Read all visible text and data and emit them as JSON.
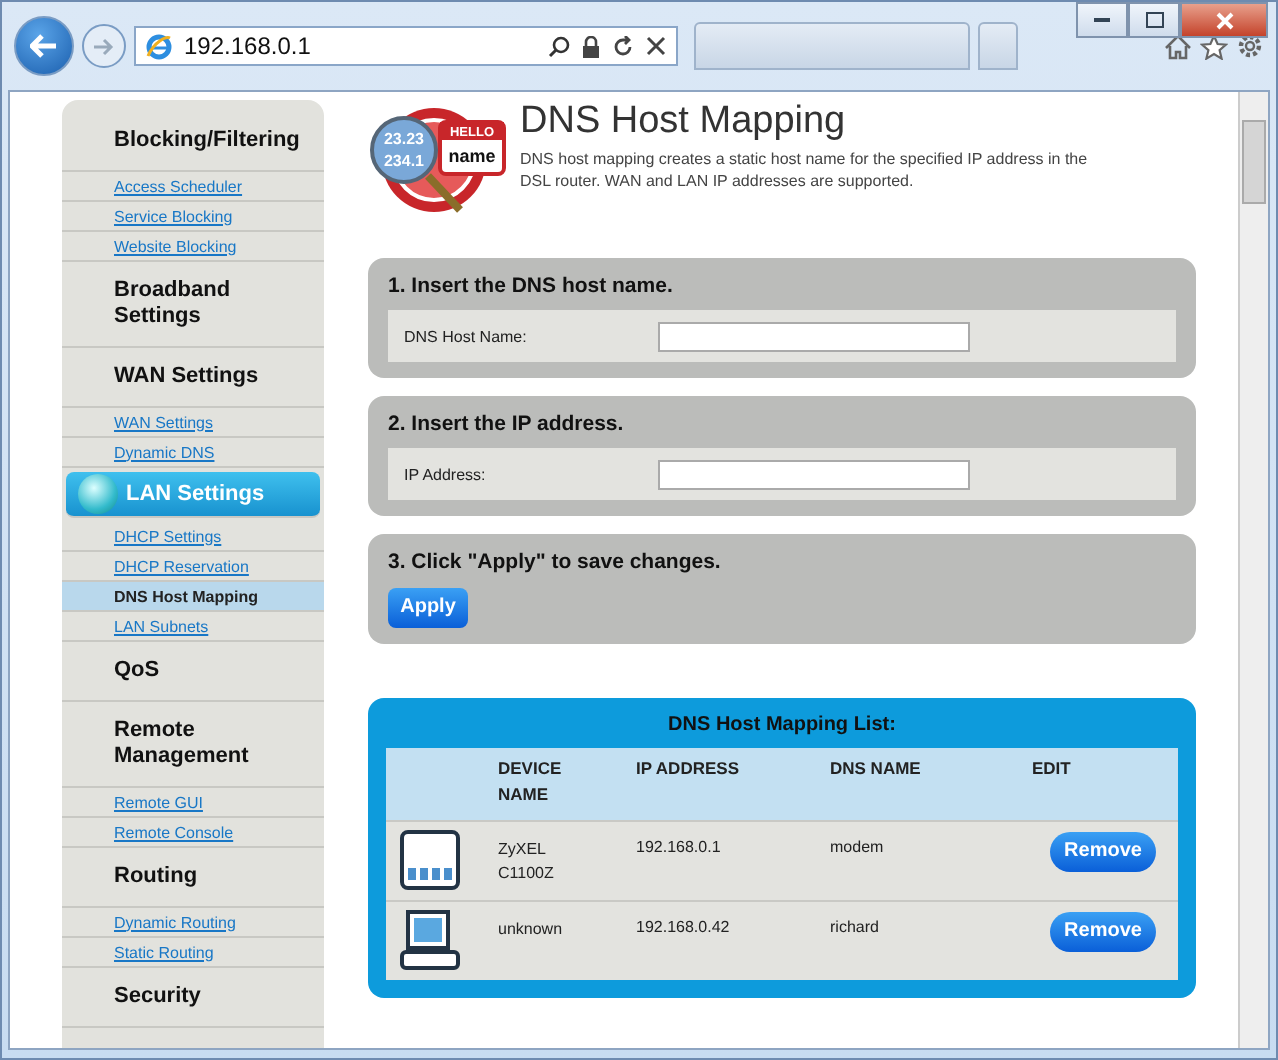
{
  "browser": {
    "address": "192.168.0.1"
  },
  "sidebar": {
    "sections": [
      {
        "title": "Blocking/Filtering",
        "selected": false,
        "links": [
          {
            "label": "Access Scheduler",
            "selected": false
          },
          {
            "label": "Service Blocking",
            "selected": false
          },
          {
            "label": "Website Blocking",
            "selected": false
          }
        ]
      },
      {
        "title": "Broadband Settings",
        "selected": false
      },
      {
        "title": "WAN Settings",
        "selected": false,
        "links": [
          {
            "label": "WAN Settings",
            "selected": false
          },
          {
            "label": "Dynamic DNS",
            "selected": false
          }
        ]
      },
      {
        "title": "LAN Settings",
        "selected": true,
        "links": [
          {
            "label": "DHCP Settings",
            "selected": false
          },
          {
            "label": "DHCP Reservation",
            "selected": false
          },
          {
            "label": "DNS Host Mapping",
            "selected": true
          },
          {
            "label": "LAN Subnets",
            "selected": false
          }
        ]
      },
      {
        "title": "QoS",
        "selected": false
      },
      {
        "title": "Remote Management",
        "selected": false,
        "links": [
          {
            "label": "Remote GUI",
            "selected": false
          },
          {
            "label": "Remote Console",
            "selected": false
          }
        ]
      },
      {
        "title": "Routing",
        "selected": false,
        "links": [
          {
            "label": "Dynamic Routing",
            "selected": false
          },
          {
            "label": "Static Routing",
            "selected": false
          }
        ]
      },
      {
        "title": "Security",
        "selected": false
      }
    ]
  },
  "header": {
    "title": "DNS Host Mapping",
    "description": "DNS host mapping creates a static host name for the specified IP address in the DSL router. WAN and LAN IP addresses are supported.",
    "logo": {
      "numbers": [
        "23.23",
        "234.1"
      ],
      "badge": "HELLO",
      "badge_text": "name"
    }
  },
  "steps": [
    {
      "title": "1. Insert the DNS host name.",
      "field_label": "DNS Host Name:"
    },
    {
      "title": "2. Insert the IP address.",
      "field_label": "IP Address:"
    },
    {
      "title": "3. Click \"Apply\" to save changes.",
      "button": "Apply"
    }
  ],
  "list": {
    "title": "DNS Host Mapping List:",
    "columns": [
      "DEVICE NAME",
      "IP ADDRESS",
      "DNS NAME",
      "EDIT"
    ],
    "rows": [
      {
        "kind": "modem",
        "device_name": "ZyXEL C1100Z",
        "ip_address": "192.168.0.1",
        "dns_name": "modem",
        "button": "Remove"
      },
      {
        "kind": "computer",
        "device_name": "unknown",
        "ip_address": "192.168.0.42",
        "dns_name": "richard",
        "button": "Remove"
      }
    ]
  }
}
